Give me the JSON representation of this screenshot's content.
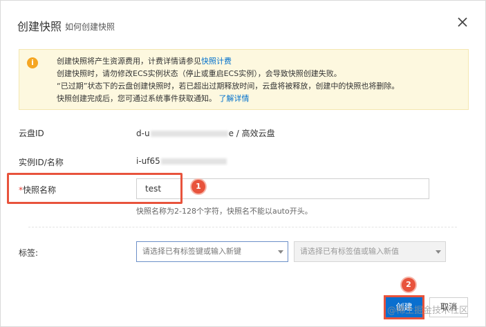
{
  "dialog": {
    "title": "创建快照",
    "title_link": "如何创建快照"
  },
  "notice": {
    "lines": [
      {
        "text": "创建快照将产生资源费用，计费详情请参见",
        "link": "快照计费"
      },
      {
        "text": "创建快照时，请勿修改ECS实例状态（停止或重启ECS实例），会导致快照创建失败。",
        "link": ""
      },
      {
        "text": "“已过期”状态下的云盘创建快照时，若已超出过期释放时间，云盘将被释放，创建中的快照也将删除。",
        "link": ""
      },
      {
        "text": "快照创建完成后，您可通过系统事件获取通知。",
        "link": "了解详情"
      }
    ]
  },
  "form": {
    "disk_id_label": "云盘ID",
    "disk_id_prefix": "d-u",
    "disk_id_suffix": "e / 高效云盘",
    "instance_label": "实例ID/名称",
    "instance_prefix": "i-uf65",
    "snapshot_name_star": "*",
    "snapshot_name_label": "快照名称",
    "snapshot_name_value": "test",
    "snapshot_name_hint": "快照名称为2-128个字符，快照名不能以auto开头。",
    "tags_label": "标签:",
    "tag_key_placeholder": "请选择已有标签键或输入新键",
    "tag_value_placeholder": "请选择已有标签值或输入新值"
  },
  "annotations": {
    "step1": "1",
    "step2": "2"
  },
  "footer": {
    "create_label": "创建",
    "cancel_label": "取消"
  },
  "watermark": "@稀土掘金技术社区",
  "colors": {
    "primary": "#0a6fcf",
    "annotation_red": "#e8533c",
    "notice_bg": "#fdf8df",
    "link": "#0070cc"
  }
}
